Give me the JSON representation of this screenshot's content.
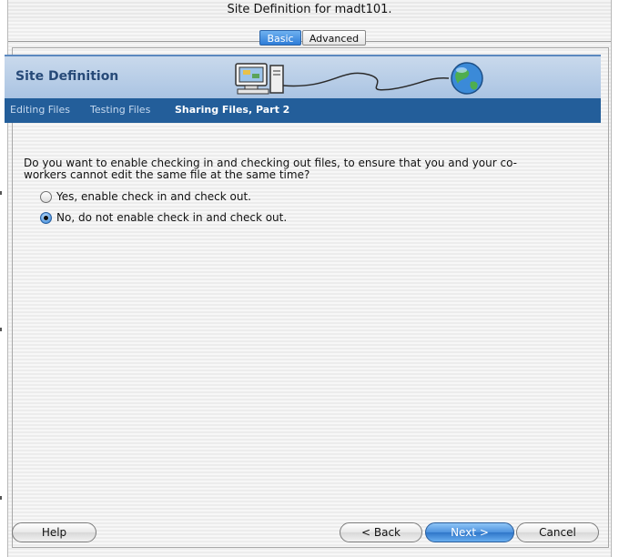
{
  "window": {
    "title": "Site Definition for madt101."
  },
  "tabs": [
    {
      "label": "Basic",
      "selected": true
    },
    {
      "label": "Advanced",
      "selected": false
    }
  ],
  "header": {
    "title": "Site Definition"
  },
  "steps": [
    {
      "label": "Editing Files",
      "active": false
    },
    {
      "label": "Testing Files",
      "active": false
    },
    {
      "label": "Sharing Files, Part 2",
      "active": true
    }
  ],
  "content": {
    "question_line1": "Do you want to enable checking in and checking out files, to ensure that you and your co-",
    "question_line2": "workers cannot edit the same file at the same time?",
    "options": [
      {
        "label": "Yes, enable check in and check out.",
        "selected": false
      },
      {
        "label": "No, do not enable check in and check out.",
        "selected": true
      }
    ]
  },
  "buttons": {
    "help": "Help",
    "back": "< Back",
    "next": "Next >",
    "cancel": "Cancel"
  },
  "colors": {
    "header_band": "#b9cfe8",
    "nav_band": "#235e9a",
    "accent_blue": "#4d92de"
  }
}
